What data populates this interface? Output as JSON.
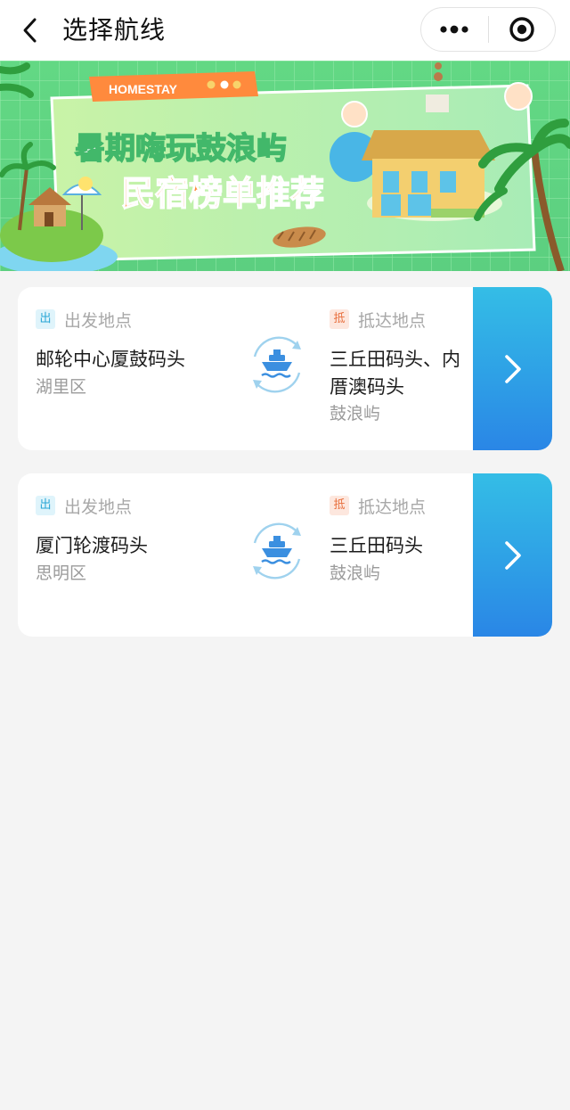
{
  "header": {
    "title": "选择航线",
    "back_icon": "chevron-left-icon",
    "more_icon": "more-dots-icon",
    "close_icon": "target-circle-icon"
  },
  "banner": {
    "badge": "HOMESTAY",
    "line1": "暑期嗨玩鼓浪屿",
    "line2": "民宿榜单推荐",
    "colors": {
      "bg": "#5fd67d",
      "accent": "#ff8a3d",
      "title": "#3fb960"
    }
  },
  "routes": [
    {
      "from_tag": "出",
      "from_label": "出发地点",
      "from_name": "邮轮中心厦鼓码头",
      "from_district": "湖里区",
      "to_tag": "抵",
      "to_label": "抵达地点",
      "to_name": "三丘田码头、内厝澳码头",
      "to_district": "鼓浪屿",
      "icon": "ship-icon",
      "action_icon": "chevron-right-icon"
    },
    {
      "from_tag": "出",
      "from_label": "出发地点",
      "from_name": "厦门轮渡码头",
      "from_district": "思明区",
      "to_tag": "抵",
      "to_label": "抵达地点",
      "to_name": "三丘田码头",
      "to_district": "鼓浪屿",
      "icon": "ship-icon",
      "action_icon": "chevron-right-icon"
    }
  ],
  "theme": {
    "card_action_gradient": [
      "#34bde6",
      "#2a86e6"
    ],
    "page_bg": "#f4f4f4"
  }
}
